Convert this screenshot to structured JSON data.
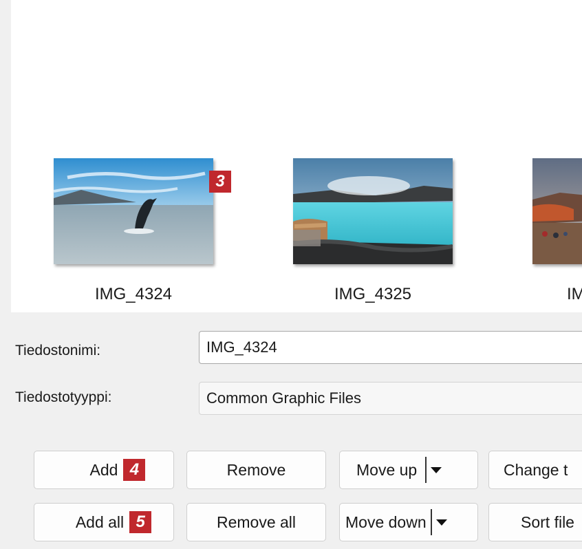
{
  "thumbnails": [
    {
      "name": "IMG_4324",
      "marker": "3"
    },
    {
      "name": "IMG_4325"
    },
    {
      "name": "IM"
    }
  ],
  "fields": {
    "filename_label": "Tiedostonimi:",
    "filename_value": "IMG_4324",
    "filetype_label": "Tiedostotyyppi:",
    "filetype_value": "Common Graphic Files"
  },
  "buttons": {
    "add": "Add",
    "add_marker": "4",
    "add_all": "Add all",
    "add_all_marker": "5",
    "remove": "Remove",
    "remove_all": "Remove all",
    "move_up": "Move up",
    "move_down": "Move down",
    "change": "Change t",
    "sort": "Sort file"
  },
  "colors": {
    "marker": "#c0282d",
    "pane": "#ffffff",
    "background": "#f0f0f0"
  }
}
